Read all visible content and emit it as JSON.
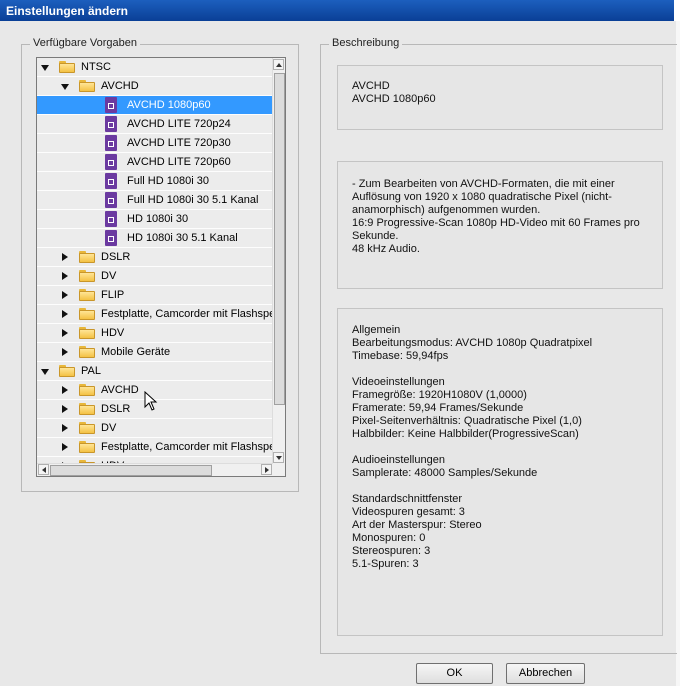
{
  "window": {
    "title": "Einstellungen ändern"
  },
  "presets_group": {
    "label": "Verfügbare Vorgaben"
  },
  "description_group": {
    "label": "Beschreibung"
  },
  "tree": {
    "rows": [
      {
        "label": "NTSC",
        "level": 0,
        "type": "folder",
        "state": "expanded"
      },
      {
        "label": "AVCHD",
        "level": 1,
        "type": "folder",
        "state": "expanded"
      },
      {
        "label": "AVCHD 1080p60",
        "level": 2,
        "type": "preset",
        "selected": true
      },
      {
        "label": "AVCHD LITE 720p24",
        "level": 2,
        "type": "preset"
      },
      {
        "label": "AVCHD LITE 720p30",
        "level": 2,
        "type": "preset"
      },
      {
        "label": "AVCHD LITE 720p60",
        "level": 2,
        "type": "preset"
      },
      {
        "label": "Full HD 1080i 30",
        "level": 2,
        "type": "preset"
      },
      {
        "label": "Full HD 1080i 30 5.1 Kanal",
        "level": 2,
        "type": "preset"
      },
      {
        "label": "HD 1080i 30",
        "level": 2,
        "type": "preset"
      },
      {
        "label": "HD 1080i 30 5.1 Kanal",
        "level": 2,
        "type": "preset"
      },
      {
        "label": "DSLR",
        "level": 1,
        "type": "folder",
        "state": "collapsed"
      },
      {
        "label": "DV",
        "level": 1,
        "type": "folder",
        "state": "collapsed"
      },
      {
        "label": "FLIP",
        "level": 1,
        "type": "folder",
        "state": "collapsed"
      },
      {
        "label": "Festplatte, Camcorder mit Flashspeicher",
        "level": 1,
        "type": "folder",
        "state": "collapsed"
      },
      {
        "label": "HDV",
        "level": 1,
        "type": "folder",
        "state": "collapsed"
      },
      {
        "label": "Mobile Geräte",
        "level": 1,
        "type": "folder",
        "state": "collapsed"
      },
      {
        "label": "PAL",
        "level": 0,
        "type": "folder",
        "state": "expanded"
      },
      {
        "label": "AVCHD",
        "level": 1,
        "type": "folder",
        "state": "collapsed"
      },
      {
        "label": "DSLR",
        "level": 1,
        "type": "folder",
        "state": "collapsed"
      },
      {
        "label": "DV",
        "level": 1,
        "type": "folder",
        "state": "collapsed"
      },
      {
        "label": "Festplatte, Camcorder mit Flashspeicher",
        "level": 1,
        "type": "folder",
        "state": "collapsed"
      },
      {
        "label": "HDV",
        "level": 1,
        "type": "folder",
        "state": "collapsed"
      }
    ]
  },
  "description": {
    "name": "AVCHD\nAVCHD 1080p60",
    "summary": "- Zum Bearbeiten von AVCHD-Formaten, die mit einer\nAuflösung von 1920 x 1080 quadratische Pixel (nicht-\nanamorphisch) aufgenommen wurden.\n16:9 Progressive-Scan 1080p HD-Video mit 60 Frames pro\nSekunde.\n48 kHz Audio.",
    "details": "Allgemein\n Bearbeitungsmodus: AVCHD 1080p Quadratpixel\n Timebase: 59,94fps\n\nVideoeinstellungen\n Framegröße: 1920H1080V (1,0000)\n Framerate: 59,94 Frames/Sekunde\n Pixel-Seitenverhältnis: Quadratische Pixel (1,0)\n Halbbilder: Keine Halbbilder(ProgressiveScan)\n\nAudioeinstellungen\n Samplerate: 48000 Samples/Sekunde\n\nStandardschnittfenster\n Videospuren gesamt: 3\n Art der Masterspur: Stereo\n Monospuren: 0\n Stereospuren: 3\n 5.1-Spuren: 3"
  },
  "buttons": {
    "ok": "OK",
    "cancel": "Abbrechen"
  },
  "colors": {
    "selection": "#3399ff",
    "titlebar": "#0a3f96",
    "preset_icon": "#6b3aa0",
    "folder": "#f4c244"
  }
}
